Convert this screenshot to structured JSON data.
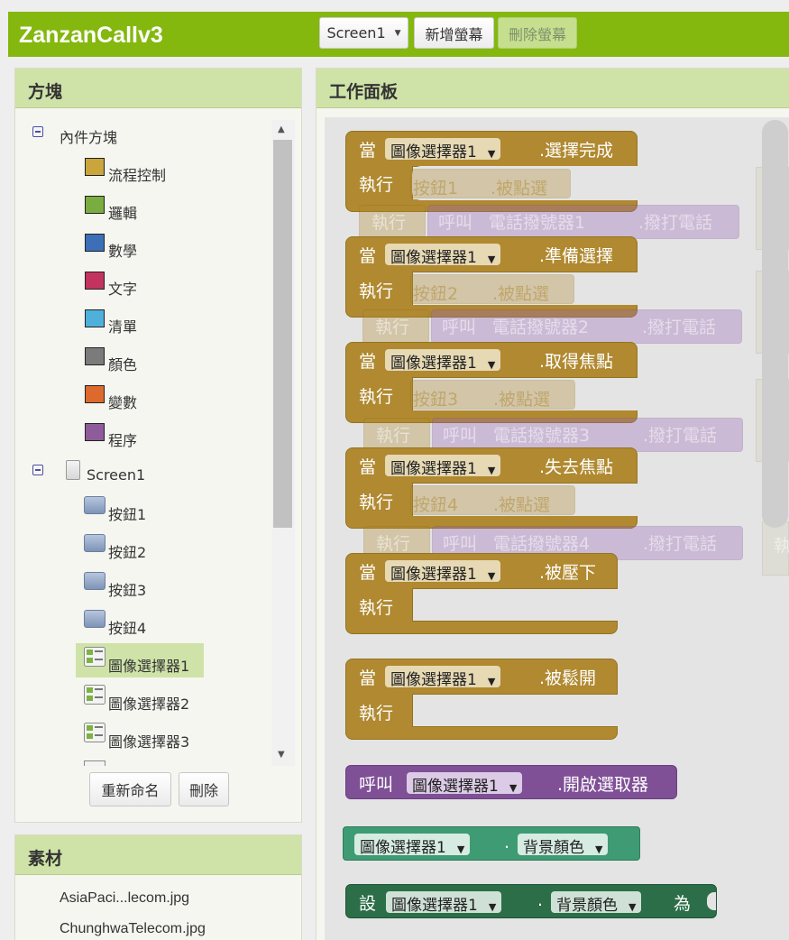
{
  "app": {
    "title": "ZanzanCallv3",
    "screen_select": "Screen1",
    "add_screen": "新增螢幕",
    "remove_screen": "刪除螢幕"
  },
  "blocks_panel": {
    "title": "方塊",
    "builtin_label": "內件方塊",
    "builtin": [
      {
        "label": "流程控制",
        "color": "#c9a53c"
      },
      {
        "label": "邏輯",
        "color": "#79ad3f"
      },
      {
        "label": "數學",
        "color": "#3d6fb8"
      },
      {
        "label": "文字",
        "color": "#c2345f"
      },
      {
        "label": "清單",
        "color": "#4fb0db"
      },
      {
        "label": "顏色",
        "color": "#7b7b7b"
      },
      {
        "label": "變數",
        "color": "#dd6a2c"
      },
      {
        "label": "程序",
        "color": "#8f5c9b"
      }
    ],
    "screen_label": "Screen1",
    "components": [
      "按鈕1",
      "按鈕2",
      "按鈕3",
      "按鈕4",
      "圖像選擇器1",
      "圖像選擇器2",
      "圖像選擇器3"
    ],
    "rename_button": "重新命名",
    "delete_button": "刪除"
  },
  "media_panel": {
    "title": "素材",
    "files": [
      "AsiaPaci...lecom.jpg",
      "ChunghwaTelecom.jpg"
    ]
  },
  "workspace": {
    "title": "工作面板",
    "kw_when": "當",
    "kw_do": "執行",
    "kw_call": "呼叫",
    "kw_set": "設",
    "kw_to": "為",
    "component": "圖像選擇器1",
    "events": [
      ".選擇完成",
      ".準備選擇",
      ".取得焦點",
      ".失去焦點",
      ".被壓下",
      ".被鬆開"
    ],
    "ghost_buttons": [
      "按鈕1",
      "按鈕2",
      "按鈕3",
      "按鈕4"
    ],
    "ghost_event": ".被點選",
    "ghost_phones": [
      "電話撥號器1",
      "電話撥號器2",
      "電話撥號器3",
      "電話撥號器4"
    ],
    "ghost_method": ".撥打電話",
    "method": ".開啟選取器",
    "property": "背景顏色",
    "dot": "."
  }
}
